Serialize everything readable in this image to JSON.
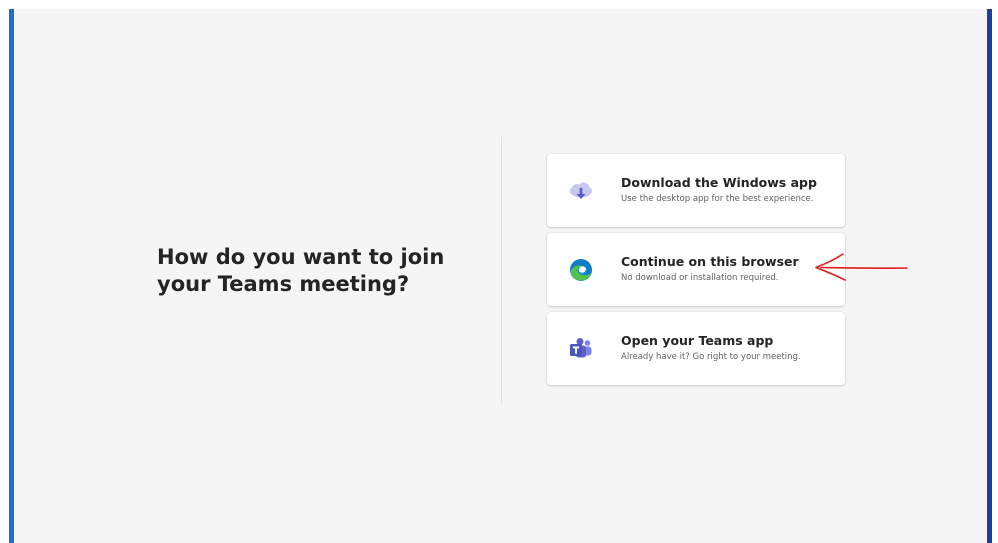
{
  "join_page": {
    "heading": "How do you want to join your Teams meeting?",
    "options": [
      {
        "title": "Download the Windows app",
        "subtitle": "Use the desktop app for the best experience.",
        "icon": "cloud-download-icon"
      },
      {
        "title": "Continue on this browser",
        "subtitle": "No download or installation required.",
        "icon": "edge-browser-icon"
      },
      {
        "title": "Open your Teams app",
        "subtitle": "Already have it? Go right to your meeting.",
        "icon": "teams-icon"
      }
    ]
  },
  "annotation": {
    "type": "red-arrow",
    "points_to": "Continue on this browser",
    "color": "#e01b1b"
  },
  "colors": {
    "left_border": "#1e6fd0",
    "right_border": "#1c3f9e",
    "panel_background": "#f5f5f5",
    "teams_purple": "#5b5fc7"
  }
}
